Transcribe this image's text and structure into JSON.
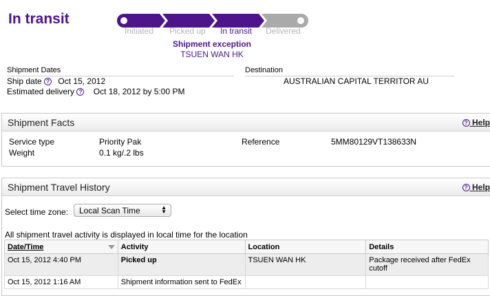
{
  "status": {
    "title": "In transit"
  },
  "progress": {
    "steps": [
      "Initiated",
      "Picked up",
      "In transit",
      "Delivered"
    ],
    "current_index": 2,
    "colors": {
      "done": "#4d148c",
      "pending": "#aaaaaa",
      "current_label": "#4d148c",
      "inactive_label": "#b5b5b5"
    }
  },
  "exception": {
    "title": "Shipment exception",
    "location": "TSUEN WAN HK"
  },
  "dates": {
    "section_title": "Shipment Dates",
    "ship_date_label": "Ship date",
    "ship_date_value": "Oct 15, 2012",
    "est_delivery_label": "Estimated delivery",
    "est_delivery_value": "Oct 18, 2012 by 5:00 PM"
  },
  "destination": {
    "section_title": "Destination",
    "value": "AUSTRALIAN CAPITAL TERRITOR AU"
  },
  "facts": {
    "title": "Shipment Facts",
    "help": "Help",
    "service_type_label": "Service type",
    "service_type_value": "Priority Pak",
    "weight_label": "Weight",
    "weight_value": "0.1 kg/.2 lbs",
    "reference_label": "Reference",
    "reference_value": "5MM80129VT138633N"
  },
  "history": {
    "title": "Shipment Travel History",
    "help": "Help",
    "timezone_label": "Select time zone:",
    "timezone_value": "Local Scan Time",
    "note": "All shipment travel activity is displayed in local time for the location",
    "columns": [
      "Date/Time",
      "Activity",
      "Location",
      "Details"
    ],
    "rows": [
      {
        "datetime": "Oct 15, 2012 4:40 PM",
        "activity": "Picked up",
        "location": "TSUEN WAN HK",
        "details": "Package received after FedEx cutoff"
      },
      {
        "datetime": "Oct 15, 2012 1:16 AM",
        "activity": "Shipment information sent to FedEx",
        "location": "",
        "details": ""
      }
    ]
  }
}
